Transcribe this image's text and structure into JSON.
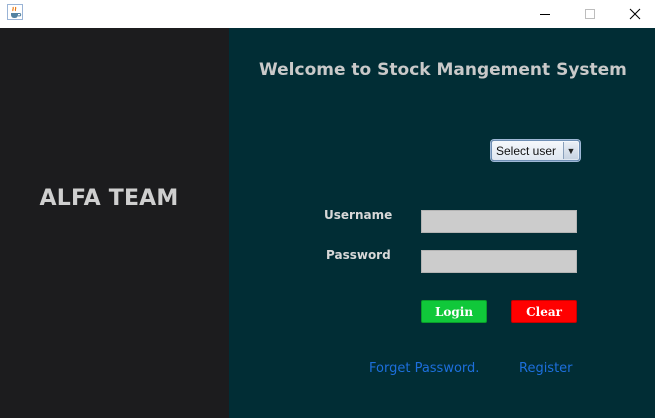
{
  "window": {
    "icon": "java-cup-icon",
    "controls": [
      "minimize-icon",
      "maximize-icon",
      "close-icon"
    ]
  },
  "left_panel": {
    "brand": "ALFA TEAM"
  },
  "main": {
    "welcome": "Welcome to Stock Mangement System",
    "user_select": {
      "selected": "Select user"
    },
    "username_label": "Username",
    "password_label": "Password",
    "username_value": "",
    "password_value": "",
    "login_label": "Login",
    "clear_label": "Clear",
    "forget_link": "Forget Password.",
    "register_link": "Register"
  },
  "colors": {
    "left_bg": "#1c1c1e",
    "right_bg": "#012d35",
    "login_bg": "#10c83a",
    "clear_bg": "#ff0000",
    "link": "#1d6fdc"
  }
}
